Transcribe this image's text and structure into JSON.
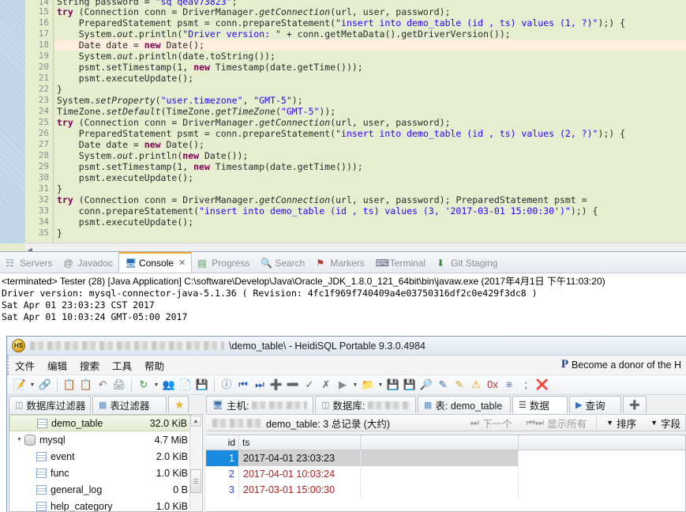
{
  "editor": {
    "first_visible_line": 14,
    "highlighted_line": 18,
    "lines": [
      {
        "n": 14,
        "clipped": true,
        "text": "String password = \"sq_qeav73823\";"
      },
      {
        "n": 15,
        "text": "try (Connection conn = DriverManager.getConnection(url, user, password);"
      },
      {
        "n": 16,
        "text": "    PreparedStatement psmt = conn.prepareStatement(\"insert into demo_table (id , ts) values (1, ?)\");) {"
      },
      {
        "n": 17,
        "text": "    System.out.println(\"Driver version: \" + conn.getMetaData().getDriverVersion());"
      },
      {
        "n": 18,
        "text": "    Date date = new Date();"
      },
      {
        "n": 19,
        "text": "    System.out.println(date.toString());"
      },
      {
        "n": 20,
        "text": "    psmt.setTimestamp(1, new Timestamp(date.getTime()));"
      },
      {
        "n": 21,
        "text": "    psmt.executeUpdate();"
      },
      {
        "n": 22,
        "text": "}"
      },
      {
        "n": 23,
        "text": "System.setProperty(\"user.timezone\", \"GMT-5\");"
      },
      {
        "n": 24,
        "text": "TimeZone.setDefault(TimeZone.getTimeZone(\"GMT-5\"));"
      },
      {
        "n": 25,
        "text": "try (Connection conn = DriverManager.getConnection(url, user, password);"
      },
      {
        "n": 26,
        "text": "    PreparedStatement psmt = conn.prepareStatement(\"insert into demo_table (id , ts) values (2, ?)\");) {"
      },
      {
        "n": 27,
        "text": "    Date date = new Date();"
      },
      {
        "n": 28,
        "text": "    System.out.println(new Date());"
      },
      {
        "n": 29,
        "text": "    psmt.setTimestamp(1, new Timestamp(date.getTime()));"
      },
      {
        "n": 30,
        "text": "    psmt.executeUpdate();"
      },
      {
        "n": 31,
        "text": "}"
      },
      {
        "n": 32,
        "text": "try (Connection conn = DriverManager.getConnection(url, user, password); PreparedStatement psmt ="
      },
      {
        "n": 33,
        "text": "    conn.prepareStatement(\"insert into demo_table (id , ts) values (3, '2017-03-01 15:00:30')\");) {"
      },
      {
        "n": 34,
        "text": "    psmt.executeUpdate();"
      },
      {
        "n": 35,
        "text": "}"
      }
    ]
  },
  "console": {
    "tabs": [
      {
        "label": "Servers",
        "icon": "servers-icon",
        "active": false,
        "closable": false
      },
      {
        "label": "Javadoc",
        "icon": "javadoc-icon",
        "active": false,
        "closable": false
      },
      {
        "label": "Console",
        "icon": "console-icon",
        "active": true,
        "closable": true,
        "close_glyph": "✕"
      },
      {
        "label": "Progress",
        "icon": "progress-icon",
        "active": false,
        "closable": false
      },
      {
        "label": "Search",
        "icon": "search-icon",
        "active": false,
        "closable": false
      },
      {
        "label": "Markers",
        "icon": "markers-icon",
        "active": false,
        "closable": false
      },
      {
        "label": "Terminal",
        "icon": "terminal-icon",
        "active": false,
        "closable": false
      },
      {
        "label": "Git Staging",
        "icon": "git-staging-icon",
        "active": false,
        "closable": false
      }
    ],
    "header": "<terminated> Tester (28) [Java Application] C:\\software\\Develop\\Java\\Oracle_JDK_1.8.0_121_64bit\\bin\\javaw.exe (2017年4月1日 下午11:03:20)",
    "output": "Driver version: mysql-connector-java-5.1.36 ( Revision: 4fc1f969f740409a4e03750316df2c0e429f3dc8 )\nSat Apr 01 23:03:23 CST 2017\nSat Apr 01 10:03:24 GMT-05:00 2017"
  },
  "heidi": {
    "title_prefix_redacted": true,
    "title": "\\demo_table\\ - HeidiSQL Portable 9.3.0.4984",
    "logo_text": "HS",
    "menu": [
      "文件",
      "编辑",
      "搜索",
      "工具",
      "帮助"
    ],
    "donor_text": "Become a donor of the H",
    "paypal_glyph": "P",
    "toolbar_icons": [
      "new-session-icon",
      "dropdown-arrow",
      "connect-icon",
      "separator",
      "copy-icon",
      "paste-icon",
      "undo-icon",
      "print-icon",
      "separator",
      "refresh-icon",
      "dropdown-arrow",
      "users-icon",
      "new-query-icon",
      "save-as-icon",
      "separator",
      "help-icon",
      "first-icon",
      "last-icon",
      "add-icon",
      "remove-icon",
      "apply-icon",
      "cancel-icon",
      "run-icon",
      "dropdown-arrow",
      "open-folder-icon",
      "dropdown-arrow",
      "save-icon",
      "save-all-icon",
      "find-icon",
      "replace-icon",
      "edit-icon",
      "warning-icon",
      "hex-icon",
      "format-icon",
      "semicolon-icon",
      "stop-icon"
    ],
    "left_tabs": [
      {
        "label": "数据库过滤器",
        "icon": "database-filter-icon",
        "selected": false
      },
      {
        "label": "表过滤器",
        "icon": "table-filter-icon",
        "selected": false
      },
      {
        "label": "",
        "icon": "favorite-star-icon",
        "selected": false
      }
    ],
    "right_tabs": [
      {
        "label": "主机:",
        "icon": "host-icon",
        "value_redacted": true,
        "selected": false
      },
      {
        "label": "数据库:",
        "icon": "database-icon",
        "value_redacted": true,
        "selected": false
      },
      {
        "label": "表: demo_table",
        "icon": "table-icon",
        "selected": false
      },
      {
        "label": "数据",
        "icon": "data-icon",
        "selected": true
      },
      {
        "label": "查询",
        "icon": "query-play-icon",
        "selected": false
      },
      {
        "label": "",
        "icon": "new-tab-icon",
        "selected": false
      }
    ],
    "tree": [
      {
        "label": "demo_table",
        "size": "32.0 KiB",
        "icon": "table-icon",
        "indent": 2,
        "selected": true,
        "expander": null
      },
      {
        "label": "mysql",
        "size": "4.7 MiB",
        "icon": "database-icon",
        "indent": 1,
        "selected": false,
        "expander": "expanded"
      },
      {
        "label": "event",
        "size": "2.0 KiB",
        "icon": "table-icon",
        "indent": 2,
        "selected": false,
        "expander": null
      },
      {
        "label": "func",
        "size": "1.0 KiB",
        "icon": "table-icon",
        "indent": 2,
        "selected": false,
        "expander": null
      },
      {
        "label": "general_log",
        "size": "0 B",
        "icon": "table-log-icon",
        "indent": 2,
        "selected": false,
        "expander": null
      },
      {
        "label": "help_category",
        "size": "1.0 KiB",
        "icon": "table-icon",
        "indent": 2,
        "selected": false,
        "expander": null
      }
    ],
    "grid_info": {
      "db_redacted": true,
      "label": "demo_table: 3 总记录 (大约)",
      "next_label": "下一个",
      "show_all_label": "显示所有",
      "sort_label": "排序",
      "fields_label": "字段"
    },
    "grid": {
      "columns": [
        "id",
        "ts"
      ],
      "rows": [
        {
          "id": "1",
          "ts": "2017-04-01 23:03:23",
          "selected": true
        },
        {
          "id": "2",
          "ts": "2017-04-01 10:03:24",
          "selected": false
        },
        {
          "id": "3",
          "ts": "2017-03-01 15:00:30",
          "selected": false
        }
      ]
    }
  },
  "colors": {
    "editor_bg": "#e7eed0",
    "keyword": "#7f0055",
    "string": "#2a00ff",
    "highlight_line": "#fdeede",
    "grid_id": "#1a3fd4",
    "grid_ts": "#b22020",
    "selected_cell": "#1a8ae0",
    "tab_accent": "#f9a825"
  }
}
